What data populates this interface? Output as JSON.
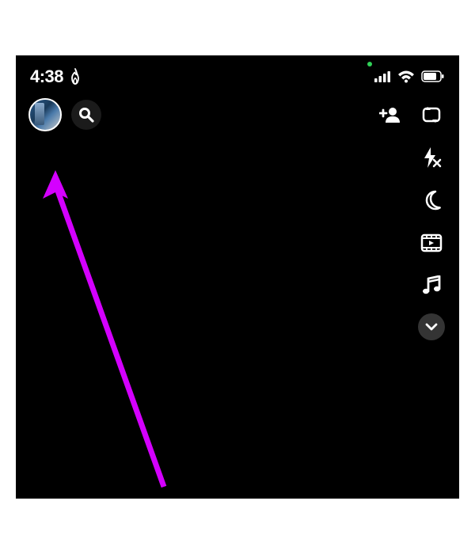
{
  "status_bar": {
    "time": "4:38",
    "streak_icon": "flame-icon",
    "privacy_indicator": "camera-active",
    "signal_icon": "cellular-signal-icon",
    "wifi_icon": "wifi-icon",
    "battery_icon": "battery-icon"
  },
  "top_left": {
    "avatar_label": "profile-avatar",
    "search_label": "search"
  },
  "top_right": {
    "add_friend_label": "add-friend"
  },
  "camera_tools": {
    "items": [
      {
        "name": "flip-camera-icon"
      },
      {
        "name": "flash-off-icon"
      },
      {
        "name": "night-mode-icon"
      },
      {
        "name": "video-timeline-icon"
      },
      {
        "name": "music-icon"
      }
    ],
    "expand_label": "expand-tools"
  },
  "annotation": {
    "arrow_color": "#d400ff",
    "target": "profile-avatar"
  }
}
